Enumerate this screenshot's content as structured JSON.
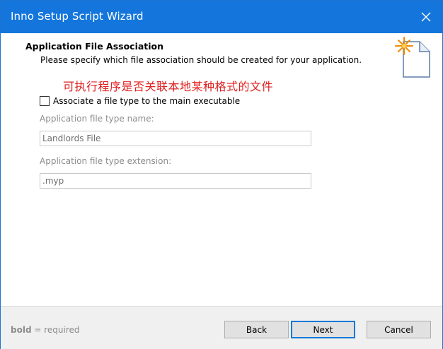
{
  "window": {
    "title": "Inno Setup Script Wizard",
    "close_icon": "close-icon"
  },
  "page": {
    "title": "Application File Association",
    "description": "Please specify which file association should be created for your application.",
    "annotation": "可执行程序是否关联本地某种格式的文件",
    "icon": "wizard-document-icon"
  },
  "form": {
    "associate_checkbox": {
      "label": "Associate a file type to the main executable",
      "checked": false
    },
    "file_type_name": {
      "label": "Application file type name:",
      "value": "Landlords File"
    },
    "file_type_extension": {
      "label": "Application file type extension:",
      "value": ".myp"
    }
  },
  "footer": {
    "required_bold": "bold",
    "required_suffix": " = required",
    "back_label": "Back",
    "next_label": "Next",
    "cancel_label": "Cancel"
  },
  "colors": {
    "titlebar": "#1476dc",
    "annotation": "#e02020",
    "disabled_text": "#8c8c8c",
    "default_button_border": "#0078d7"
  }
}
